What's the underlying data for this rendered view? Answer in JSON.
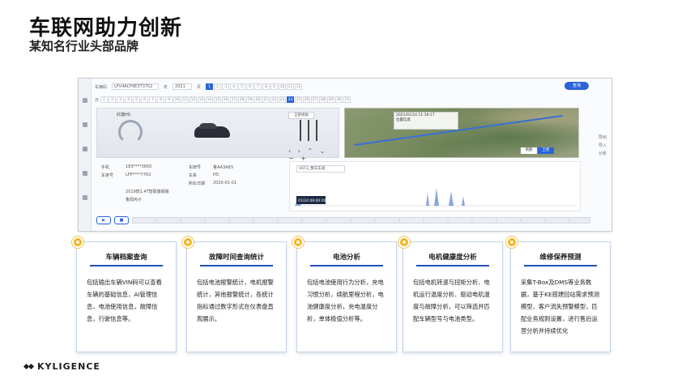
{
  "header": {
    "title": "车联网助力创新",
    "subtitle": "某知名行业头部品牌"
  },
  "screenshot": {
    "vin_label": "车辆码",
    "vin_value": "LFV4ACP9E3T3752",
    "year_label": "年",
    "year_value": "2021",
    "month_label": "月",
    "day_label": "日",
    "query_button": "查询",
    "months": [
      "1",
      "2",
      "3",
      "4",
      "5",
      "6",
      "7",
      "8",
      "9",
      "10",
      "11",
      "12"
    ],
    "days": [
      "1",
      "2",
      "3",
      "4",
      "5",
      "6",
      "7",
      "8",
      "9",
      "10",
      "11",
      "12",
      "13",
      "14",
      "15",
      "16",
      "17",
      "18",
      "19",
      "20",
      "21",
      "22",
      "23",
      "24",
      "25",
      "26",
      "27",
      "28",
      "29",
      "30",
      "31"
    ],
    "selected_day": "24",
    "car_model_label": "红旗HS",
    "view_button": "全部视角",
    "map_tip_time": "2021/01/24 11:39:17",
    "map_tip_text": "位置信息",
    "map_buttons": [
      "地图",
      "卫星"
    ],
    "right_tools": [
      "导出",
      "导入",
      "分析"
    ],
    "info": {
      "phone_label": "手机",
      "phone_value": "183****3650",
      "vin_label": "车架号",
      "vin_value": "LFP****7762",
      "plate_label": "车牌号",
      "plate_value": "鲁AA3A83",
      "series_label": "车系",
      "series_value": "HS",
      "date_label": "购车日期",
      "date_value": "2020-01-01",
      "config_value": "2019款1.4T智联旗舰版",
      "dealer_value": "鲁阳丙子"
    },
    "chart_select": "VDT2_整车车速",
    "chart_tooltip": "01/24 09:00:00"
  },
  "cards": [
    {
      "title": "车辆档案查询",
      "body": "包括输出车辆VIN码可以查看车辆的基础信息，AI管理信息，电池使用信息，故障信息，行驶信息等。"
    },
    {
      "title": "故障时间查询统计",
      "body": "包括电池报警统计，电机报警统计，其他报警统计，各统计指标通过数字形式在仪表盘直观展示。"
    },
    {
      "title": "电池分析",
      "body": "包括电池使用行为分析，充电习惯分析，续航里程分析，电池健康度分析，充电温度分析，单体极值分析等。"
    },
    {
      "title": "电机健康度分析",
      "body": "包括电机转速与扭矩分析、电机运行温度分析、驱动电机温度与故障分析，可以筛选并匹配车辆型号与电池类型。"
    },
    {
      "title": "维修保养预测",
      "body": "采集T-Box及DMS等业务数据，基于KE搭建回站需求预测模型、客户流失预警模型，匹配业务规则设置，进行售后运营分析并持续优化"
    }
  ],
  "logo": {
    "text": "KYLIGENCE"
  },
  "colors": {
    "accent": "#1f4fb6",
    "card_dot": "#f5b51e",
    "ui_blue": "#2b63d9"
  }
}
